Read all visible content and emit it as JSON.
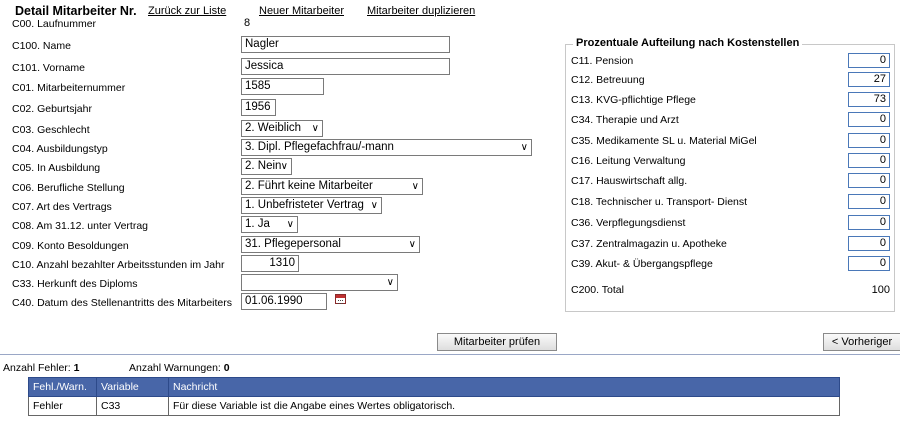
{
  "header": {
    "title": "Detail Mitarbeiter Nr.",
    "links": {
      "back": "Zurück zur Liste",
      "new": "Neuer Mitarbeiter",
      "duplicate": "Mitarbeiter duplizieren"
    }
  },
  "fields": {
    "c00": {
      "label": "C00. Laufnummer",
      "value": "8"
    },
    "c100": {
      "label": "C100. Name",
      "value": "Nagler"
    },
    "c101": {
      "label": "C101. Vorname",
      "value": "Jessica"
    },
    "c01": {
      "label": "C01. Mitarbeiternummer",
      "value": "1585"
    },
    "c02": {
      "label": "C02. Geburtsjahr",
      "value": "1956"
    },
    "c03": {
      "label": "C03. Geschlecht",
      "value": "2. Weiblich"
    },
    "c04": {
      "label": "C04. Ausbildungstyp",
      "value": "3. Dipl. Pflegefachfrau/-mann"
    },
    "c05": {
      "label": "C05. In Ausbildung",
      "value": "2. Nein"
    },
    "c06": {
      "label": "C06. Berufliche Stellung",
      "value": "2. Führt keine Mitarbeiter"
    },
    "c07": {
      "label": "C07. Art des Vertrags",
      "value": "1. Unbefristeter Vertrag"
    },
    "c08": {
      "label": "C08. Am 31.12. unter Vertrag",
      "value": "1. Ja"
    },
    "c09": {
      "label": "C09. Konto Besoldungen",
      "value": "31. Pflegepersonal"
    },
    "c10": {
      "label": "C10. Anzahl bezahlter Arbeitsstunden im Jahr",
      "value": "1310"
    },
    "c33": {
      "label": "C33. Herkunft des Diploms",
      "value": ""
    },
    "c40": {
      "label": "C40. Datum des Stellenantritts des Mitarbeiters",
      "value": "01.06.1990"
    }
  },
  "cost_panel": {
    "title": "Prozentuale Aufteilung nach Kostenstellen",
    "rows": [
      {
        "label": "C11. Pension",
        "value": "0"
      },
      {
        "label": "C12. Betreuung",
        "value": "27"
      },
      {
        "label": "C13. KVG-pflichtige Pflege",
        "value": "73"
      },
      {
        "label": "C34. Therapie und Arzt",
        "value": "0"
      },
      {
        "label": "C35. Medikamente SL u. Material MiGel",
        "value": "0"
      },
      {
        "label": "C16. Leitung Verwaltung",
        "value": "0"
      },
      {
        "label": "C17. Hauswirtschaft allg.",
        "value": "0"
      },
      {
        "label": "C18. Technischer u. Transport- Dienst",
        "value": "0"
      },
      {
        "label": "C36. Verpflegungsdienst",
        "value": "0"
      },
      {
        "label": "C37. Zentralmagazin u. Apotheke",
        "value": "0"
      },
      {
        "label": "C39. Akut- & Übergangspflege",
        "value": "0"
      }
    ],
    "total_label": "C200. Total",
    "total_value": "100"
  },
  "buttons": {
    "check": "Mitarbeiter prüfen",
    "previous": "< Vorheriger"
  },
  "summary": {
    "errors_label": "Anzahl Fehler:",
    "errors_value": "1",
    "warnings_label": "Anzahl Warnungen:",
    "warnings_value": "0"
  },
  "error_table": {
    "headers": [
      "Fehl./Warn.",
      "Variable",
      "Nachricht"
    ],
    "rows": [
      [
        "Fehler",
        "C33",
        "Für diese Variable ist die Angabe eines Wertes obligatorisch."
      ]
    ]
  },
  "colors": {
    "table_header": "#4866a8",
    "input_border_blue": "#4a78b8"
  },
  "icons": {
    "dropdown": "chevron-down-icon",
    "calendar": "calendar-icon"
  }
}
